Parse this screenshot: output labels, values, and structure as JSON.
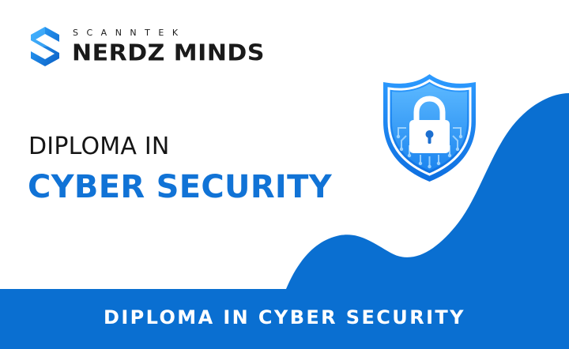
{
  "brand": {
    "top_line": "SCANNTEK",
    "main_line": "NERDZ MINDS",
    "logo_icon": "stylized-s-logo-icon"
  },
  "heading": {
    "line1": "DIPLOMA IN",
    "line2": "CYBER SECURITY"
  },
  "illustration": {
    "icon": "shield-padlock-icon"
  },
  "footer": {
    "text": "DIPLOMA IN CYBER SECURITY"
  },
  "colors": {
    "primary_blue": "#1173d6",
    "footer_blue": "#0a6fd1",
    "text_dark": "#151515",
    "background": "#ffffff"
  }
}
